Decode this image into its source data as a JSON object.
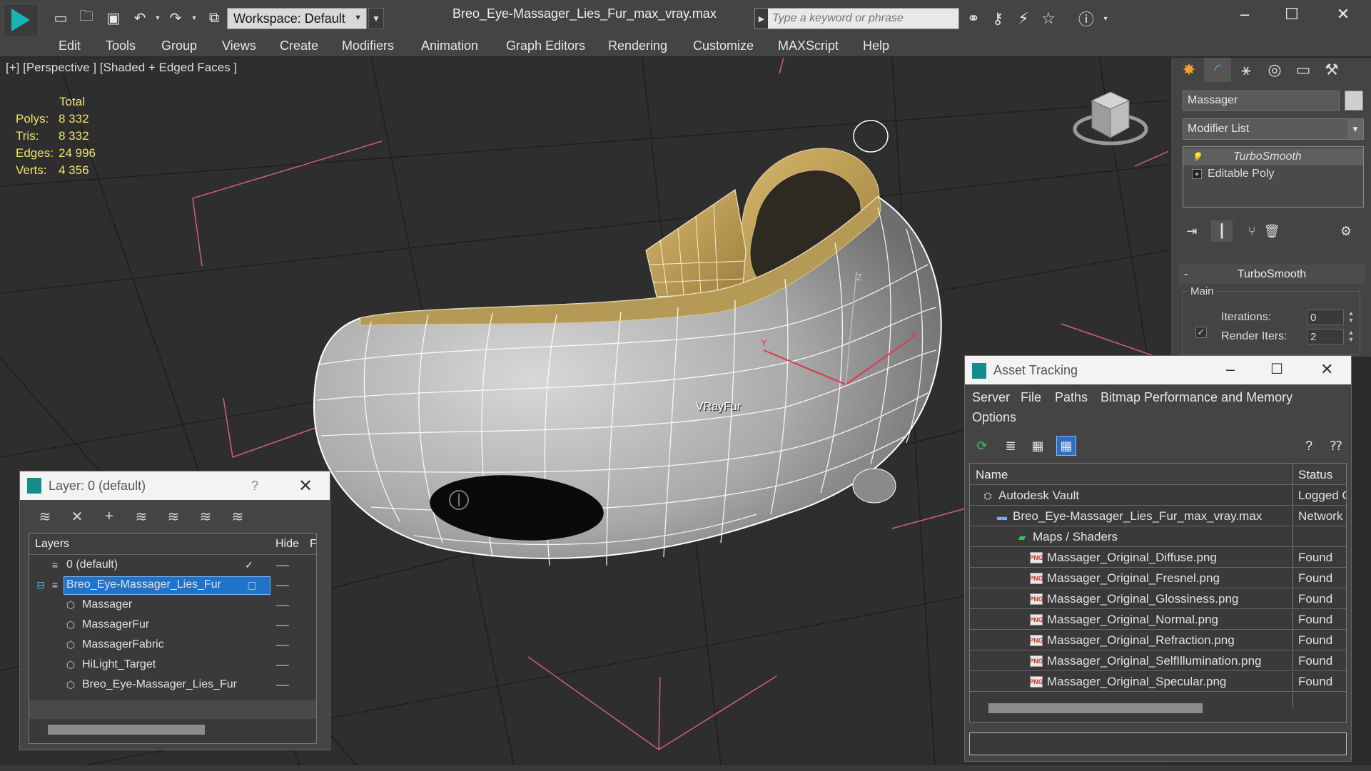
{
  "app": {
    "document_title": "Breo_Eye-Massager_Lies_Fur_max_vray.max",
    "workspace": "Workspace: Default",
    "search_placeholder": "Type a keyword or phrase"
  },
  "menu": [
    "Edit",
    "Tools",
    "Group",
    "Views",
    "Create",
    "Modifiers",
    "Animation",
    "Graph Editors",
    "Rendering",
    "Customize",
    "MAXScript",
    "Help"
  ],
  "viewport": {
    "label": "[+] [Perspective ] [Shaded + Edged Faces ]",
    "stats_header": "Total",
    "stats": [
      {
        "key": "Polys:",
        "value": "8 332"
      },
      {
        "key": "Tris:",
        "value": "8 332"
      },
      {
        "key": "Edges:",
        "value": "24 996"
      },
      {
        "key": "Verts:",
        "value": "4 356"
      }
    ],
    "object_label": "VRayFur",
    "axis_labels": {
      "x": "X",
      "y": "Y",
      "z": "Z"
    }
  },
  "command_panel": {
    "object_name": "Massager",
    "modifier_list": "Modifier List",
    "stack": [
      "TurboSmooth",
      "Editable Poly"
    ],
    "rollout_title": "TurboSmooth",
    "group_label": "Main",
    "iterations_label": "Iterations:",
    "iterations_value": "0",
    "render_iters_label": "Render Iters:",
    "render_iters_value": "2",
    "render_iters_checked": true
  },
  "layer_dialog": {
    "title": "Layer: 0 (default)",
    "help": "?",
    "columns": {
      "layers": "Layers",
      "hide": "Hide",
      "freeze": "F"
    },
    "rows": [
      {
        "name": "0 (default)",
        "level": 1,
        "active": true
      },
      {
        "name": "Breo_Eye-Massager_Lies_Fur",
        "level": 1,
        "selected": true
      },
      {
        "name": "Massager",
        "level": 2
      },
      {
        "name": "MassagerFur",
        "level": 2
      },
      {
        "name": "MassagerFabric",
        "level": 2
      },
      {
        "name": "HiLight_Target",
        "level": 2
      },
      {
        "name": "Breo_Eye-Massager_Lies_Fur",
        "level": 2
      }
    ]
  },
  "asset_dialog": {
    "title": "Asset Tracking",
    "menu": [
      "Server",
      "File",
      "Paths",
      "Bitmap Performance and Memory",
      "Options"
    ],
    "columns": {
      "name": "Name",
      "status": "Status"
    },
    "rows": [
      {
        "name": "Autodesk Vault",
        "status": "Logged O",
        "icon": "vault-icon",
        "level": 1
      },
      {
        "name": "Breo_Eye-Massager_Lies_Fur_max_vray.max",
        "status": "Network",
        "icon": "max-file-icon",
        "level": 2
      },
      {
        "name": "Maps / Shaders",
        "status": "",
        "icon": "maps-icon",
        "level": 3
      },
      {
        "name": "Massager_Original_Diffuse.png",
        "status": "Found",
        "icon": "png-icon",
        "level": 4
      },
      {
        "name": "Massager_Original_Fresnel.png",
        "status": "Found",
        "icon": "png-icon",
        "level": 4
      },
      {
        "name": "Massager_Original_Glossiness.png",
        "status": "Found",
        "icon": "png-icon",
        "level": 4
      },
      {
        "name": "Massager_Original_Normal.png",
        "status": "Found",
        "icon": "png-icon",
        "level": 4
      },
      {
        "name": "Massager_Original_Refraction.png",
        "status": "Found",
        "icon": "png-icon",
        "level": 4
      },
      {
        "name": "Massager_Original_SelfIllumination.png",
        "status": "Found",
        "icon": "png-icon",
        "level": 4
      },
      {
        "name": "Massager_Original_Specular.png",
        "status": "Found",
        "icon": "png-icon",
        "level": 4
      }
    ]
  },
  "colors": {
    "stats_text": "#f0e36a",
    "accent": "#19b3b3",
    "selection": "#1f74c9",
    "grid_lines": "#1c1c1c",
    "pink_lines": "#d0607a"
  }
}
